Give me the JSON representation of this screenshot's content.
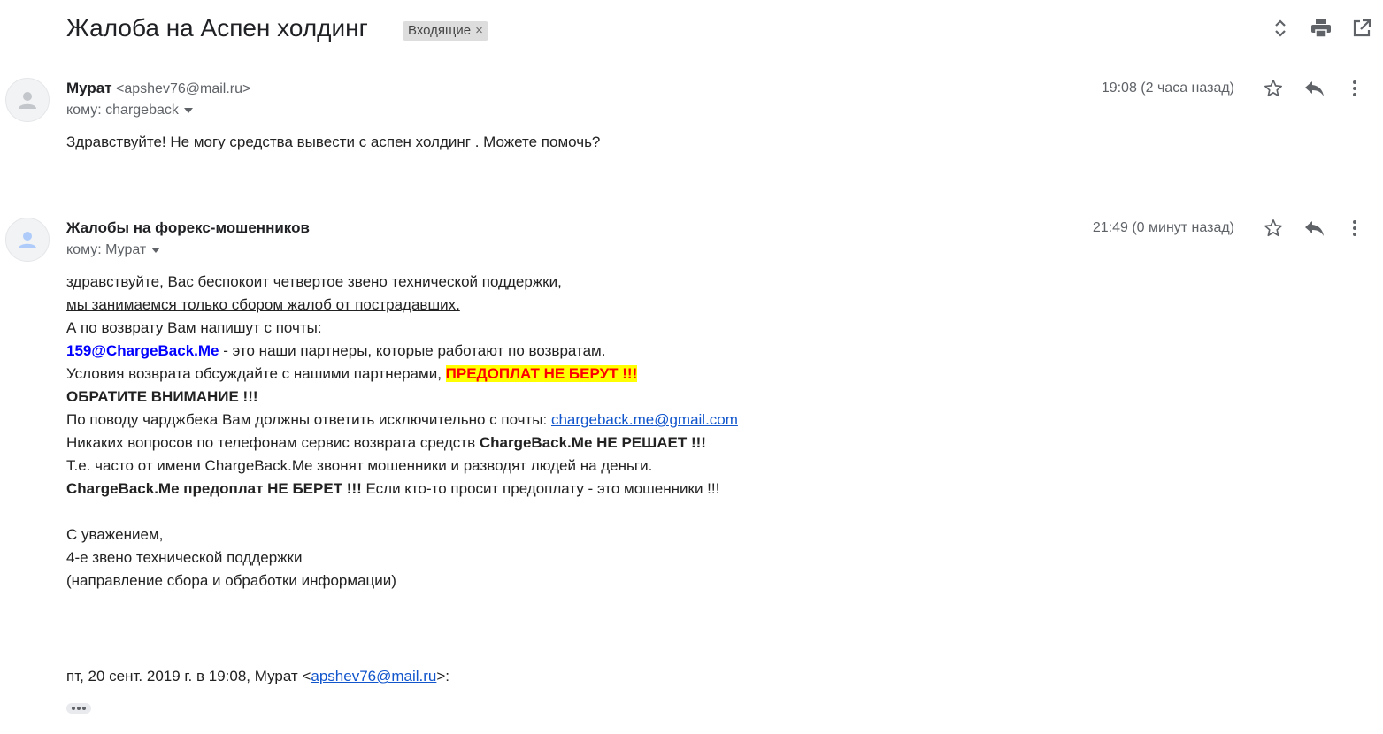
{
  "thread": {
    "subject": "Жалоба на Аспен холдинг",
    "label": "Входящие",
    "label_close": "×"
  },
  "toolbar_icons": [
    "expand-collapse-icon",
    "print-icon",
    "open-new-window-icon"
  ],
  "messages": [
    {
      "sender_name": "Мурат",
      "sender_email": "<apshev76@mail.ru>",
      "to": "кому: chargeback",
      "time": "19:08 (2 часа назад)",
      "body": "Здравствуйте! Не могу средства вывести с аспен холдинг . Можете помочь?"
    },
    {
      "sender_name": "Жалобы на форекс-мошенников",
      "to": "кому: Мурат",
      "time": "21:49 (0 минут назад)",
      "body": {
        "l1": "здравствуйте, Вас беспокоит четвертое звено технической поддержки,",
        "l2": "мы занимаемся только сбором жалоб от пострадавших.",
        "l3": "А по возврату Вам напишут с почты:",
        "l4_email": "159@ChargeBack.Me",
        "l4_rest": " - это наши партнеры, которые работают по возвратам.",
        "l5_text": "Условия возврата обсуждайте с нашими партнерами, ",
        "l5_warn": "ПРЕДОПЛАТ НЕ БЕРУТ !!!",
        "l6": "ОБРАТИТЕ ВНИМАНИЕ !!!",
        "l7_text": "По поводу чарджбека Вам должны ответить исключительно с почты: ",
        "l7_link": "chargeback.me@gmail.com",
        "l8_text": "Никаких вопросов по телефонам сервис возврата средств ",
        "l8_bold": "ChargeBack.Me НЕ РЕШАЕТ !!!",
        "l9": "Т.е. часто от имени ChargeBack.Me звонят мошенники и разводят людей на деньги.",
        "l10_bold": "ChargeBack.Me предоплат НЕ БЕРЕТ !!!",
        "l10_rest": " Если кто-то просит предоплату - это мошенники !!!",
        "sig1": "С уважением,",
        "sig2": "4-е звено технической поддержки",
        "sig3": "(направление сбора и обработки информации)",
        "quote_prefix": "пт, 20 сент. 2019 г. в 19:08, Мурат <",
        "quote_link": "apshev76@mail.ru",
        "quote_suffix": ">:"
      }
    }
  ]
}
